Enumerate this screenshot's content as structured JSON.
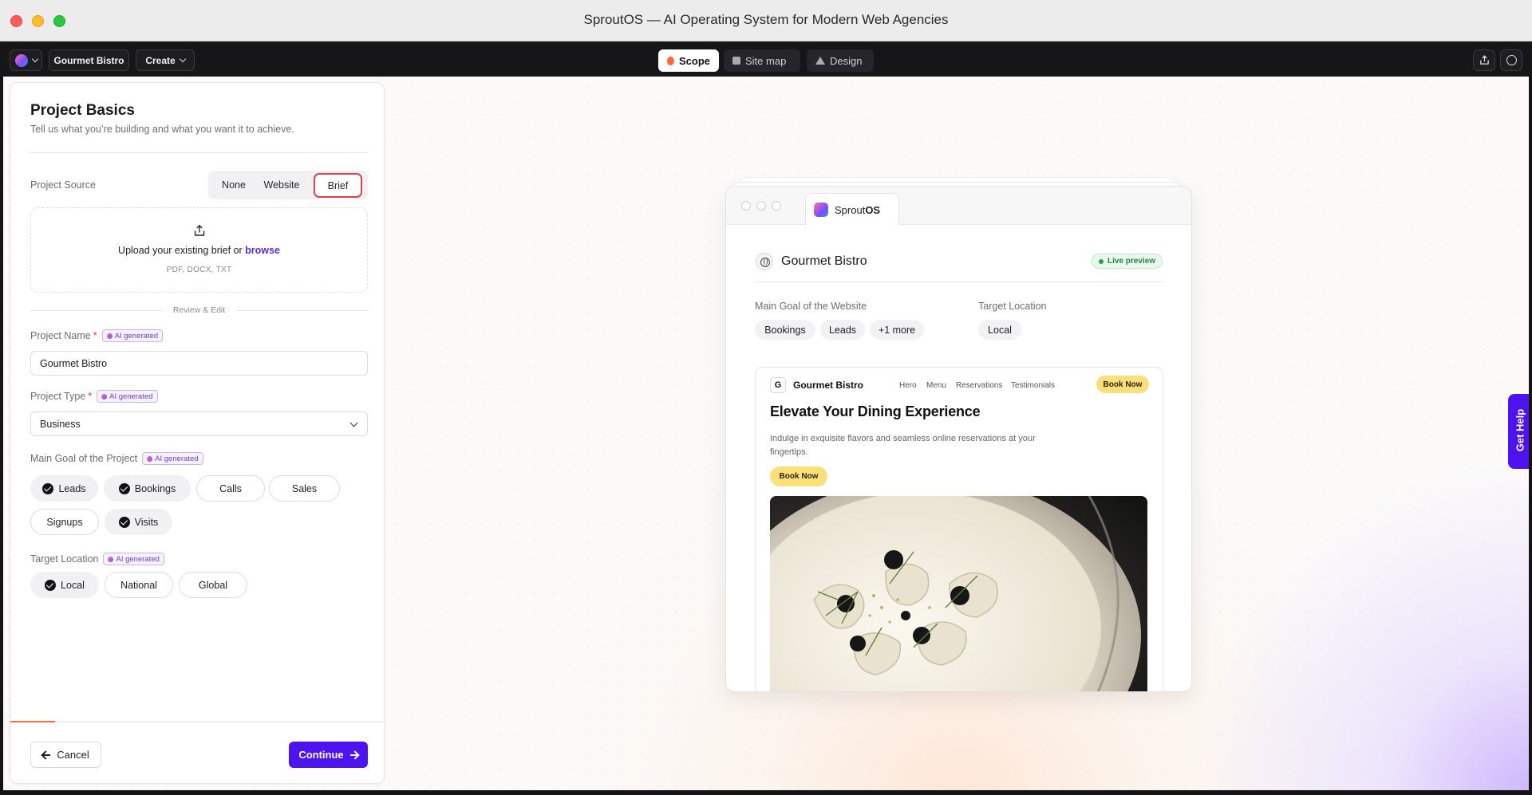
{
  "window": {
    "title": "SproutOS — AI Operating System for Modern Web Agencies"
  },
  "toolbar": {
    "project_label": "Gourmet Bistro",
    "create_label": "Create",
    "tabs": [
      {
        "label": "Scope",
        "icon": "scope-dot-icon",
        "active": true
      },
      {
        "label": "Site map",
        "icon": "sitemap-icon",
        "active": false
      },
      {
        "label": "Design",
        "icon": "design-icon",
        "active": false
      }
    ]
  },
  "panel": {
    "title": "Project Basics",
    "subtitle": "Tell us what you’re building and what you want it to achieve.",
    "source": {
      "label": "Project Source",
      "options": [
        "None",
        "Website",
        "Brief"
      ],
      "selected": "Brief"
    },
    "upload": {
      "text_prefix": "Upload your existing brief or",
      "browse": "browse",
      "hint": "PDF, DOCX, TXT"
    },
    "divider": "Review & Edit",
    "ai_badge": "AI generated",
    "name": {
      "label": "Project Name",
      "required": "*",
      "value": "Gourmet Bistro"
    },
    "type": {
      "label": "Project Type",
      "required": "*",
      "value": "Business"
    },
    "goal": {
      "label": "Main Goal of the Project",
      "options": [
        {
          "label": "Leads",
          "selected": true
        },
        {
          "label": "Bookings",
          "selected": true
        },
        {
          "label": "Calls",
          "selected": false
        },
        {
          "label": "Sales",
          "selected": false
        },
        {
          "label": "Signups",
          "selected": false
        },
        {
          "label": "Visits",
          "selected": true
        }
      ]
    },
    "location": {
      "label": "Target Location",
      "options": [
        {
          "label": "Local",
          "selected": true
        },
        {
          "label": "National",
          "selected": false
        },
        {
          "label": "Global",
          "selected": false
        }
      ]
    },
    "progress_fraction": 0.12,
    "cancel_label": "Cancel",
    "continue_label": "Continue"
  },
  "preview": {
    "tab_label_prefix": "Sprout",
    "tab_label_bold": "OS",
    "site_title": "Gourmet Bistro",
    "live_label": "Live preview",
    "goal_label": "Main Goal of the Website",
    "goal_chips": [
      "Bookings",
      "Leads",
      "+1 more"
    ],
    "location_label": "Target Location",
    "location_chips": [
      "Local"
    ],
    "site": {
      "logo_letter": "G",
      "name": "Gourmet Bistro",
      "nav": [
        "Hero",
        "Menu",
        "Reservations",
        "Testimonials"
      ],
      "book_label": "Book Now",
      "hero_heading": "Elevate Your Dining Experience",
      "hero_text": "Indulge in exquisite flavors and seamless online reservations at your fingertips.",
      "hero_button": "Book Now"
    }
  },
  "help_label": "Get Help",
  "colors": {
    "accent": "#4e14f0",
    "scope": "#ff6a3d",
    "highlight": "#e2414f",
    "cta_yellow": "#fbe07a"
  }
}
